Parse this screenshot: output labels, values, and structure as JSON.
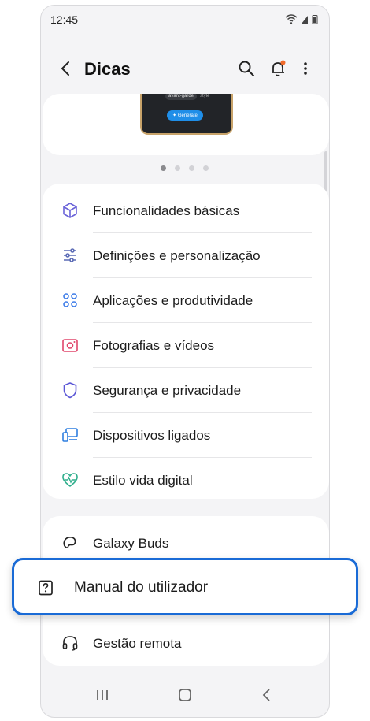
{
  "status": {
    "time": "12:45"
  },
  "header": {
    "title": "Dicas"
  },
  "banner": {
    "tag": "avant-garde",
    "tag_suffix": "style",
    "generate_label": "Generate"
  },
  "pager": {
    "count": 4,
    "active": 1
  },
  "menu_primary": [
    {
      "label": "Funcionalidades básicas",
      "icon": "cube-icon",
      "color": "#6a63d8"
    },
    {
      "label": "Definições e personalização",
      "icon": "sliders-icon",
      "color": "#5b6bb5"
    },
    {
      "label": "Aplicações e produtividade",
      "icon": "apps-grid-icon",
      "color": "#3c7be8"
    },
    {
      "label": "Fotografias e vídeos",
      "icon": "camera-icon",
      "color": "#e0466b"
    },
    {
      "label": "Segurança e privacidade",
      "icon": "shield-icon",
      "color": "#5a56d6"
    },
    {
      "label": "Dispositivos ligados",
      "icon": "devices-icon",
      "color": "#2f7fe0"
    },
    {
      "label": "Estilo vida digital",
      "icon": "heart-pulse-icon",
      "color": "#2eae8c"
    }
  ],
  "menu_secondary": [
    {
      "label": "Galaxy Buds",
      "icon": "buds-icon"
    },
    {
      "label": "Manual do utilizador",
      "icon": "help-book-icon"
    },
    {
      "label": "Gestão remota",
      "icon": "headset-icon"
    }
  ],
  "colors": {
    "highlight_border": "#1a6bd6",
    "notification_dot": "#f06a2a"
  }
}
